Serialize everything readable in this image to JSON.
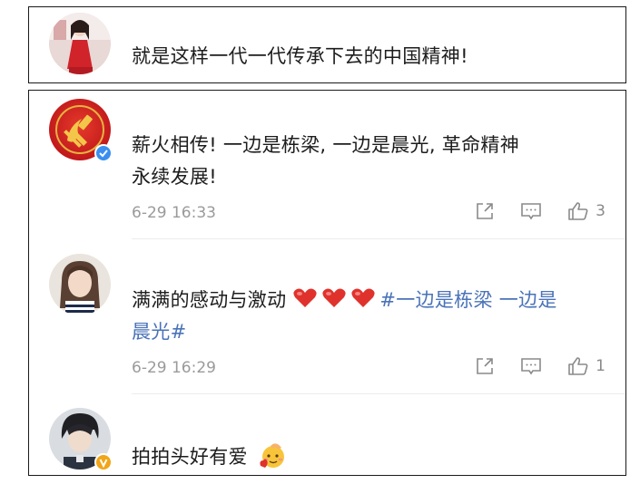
{
  "top_comment": {
    "text": "就是这样一代一代传承下去的中国精神!"
  },
  "comments": [
    {
      "text_line1": "薪火相传! 一边是栋梁, 一边是晨光, 革命精神",
      "text_line2": "永续发展!",
      "time": "6-29 16:33",
      "likes": "3",
      "badge_color": "#3b8ef0"
    },
    {
      "text_prefix": "满满的感动与激动",
      "hashtag_line1": "#一边是栋梁 一边是",
      "hashtag_line2": "晨光#",
      "time": "6-29 16:29",
      "likes": "1"
    },
    {
      "text": "拍拍头好有爱",
      "emoji": "pat-head-emoji",
      "badge_color": "#f2a516"
    }
  ],
  "icons": {
    "share": "share-icon",
    "comment": "comment-icon",
    "like": "thumbs-up-icon"
  },
  "colors": {
    "hashtag": "#4a73b8",
    "meta": "#9a9a9a",
    "heart": "#e0322c"
  }
}
